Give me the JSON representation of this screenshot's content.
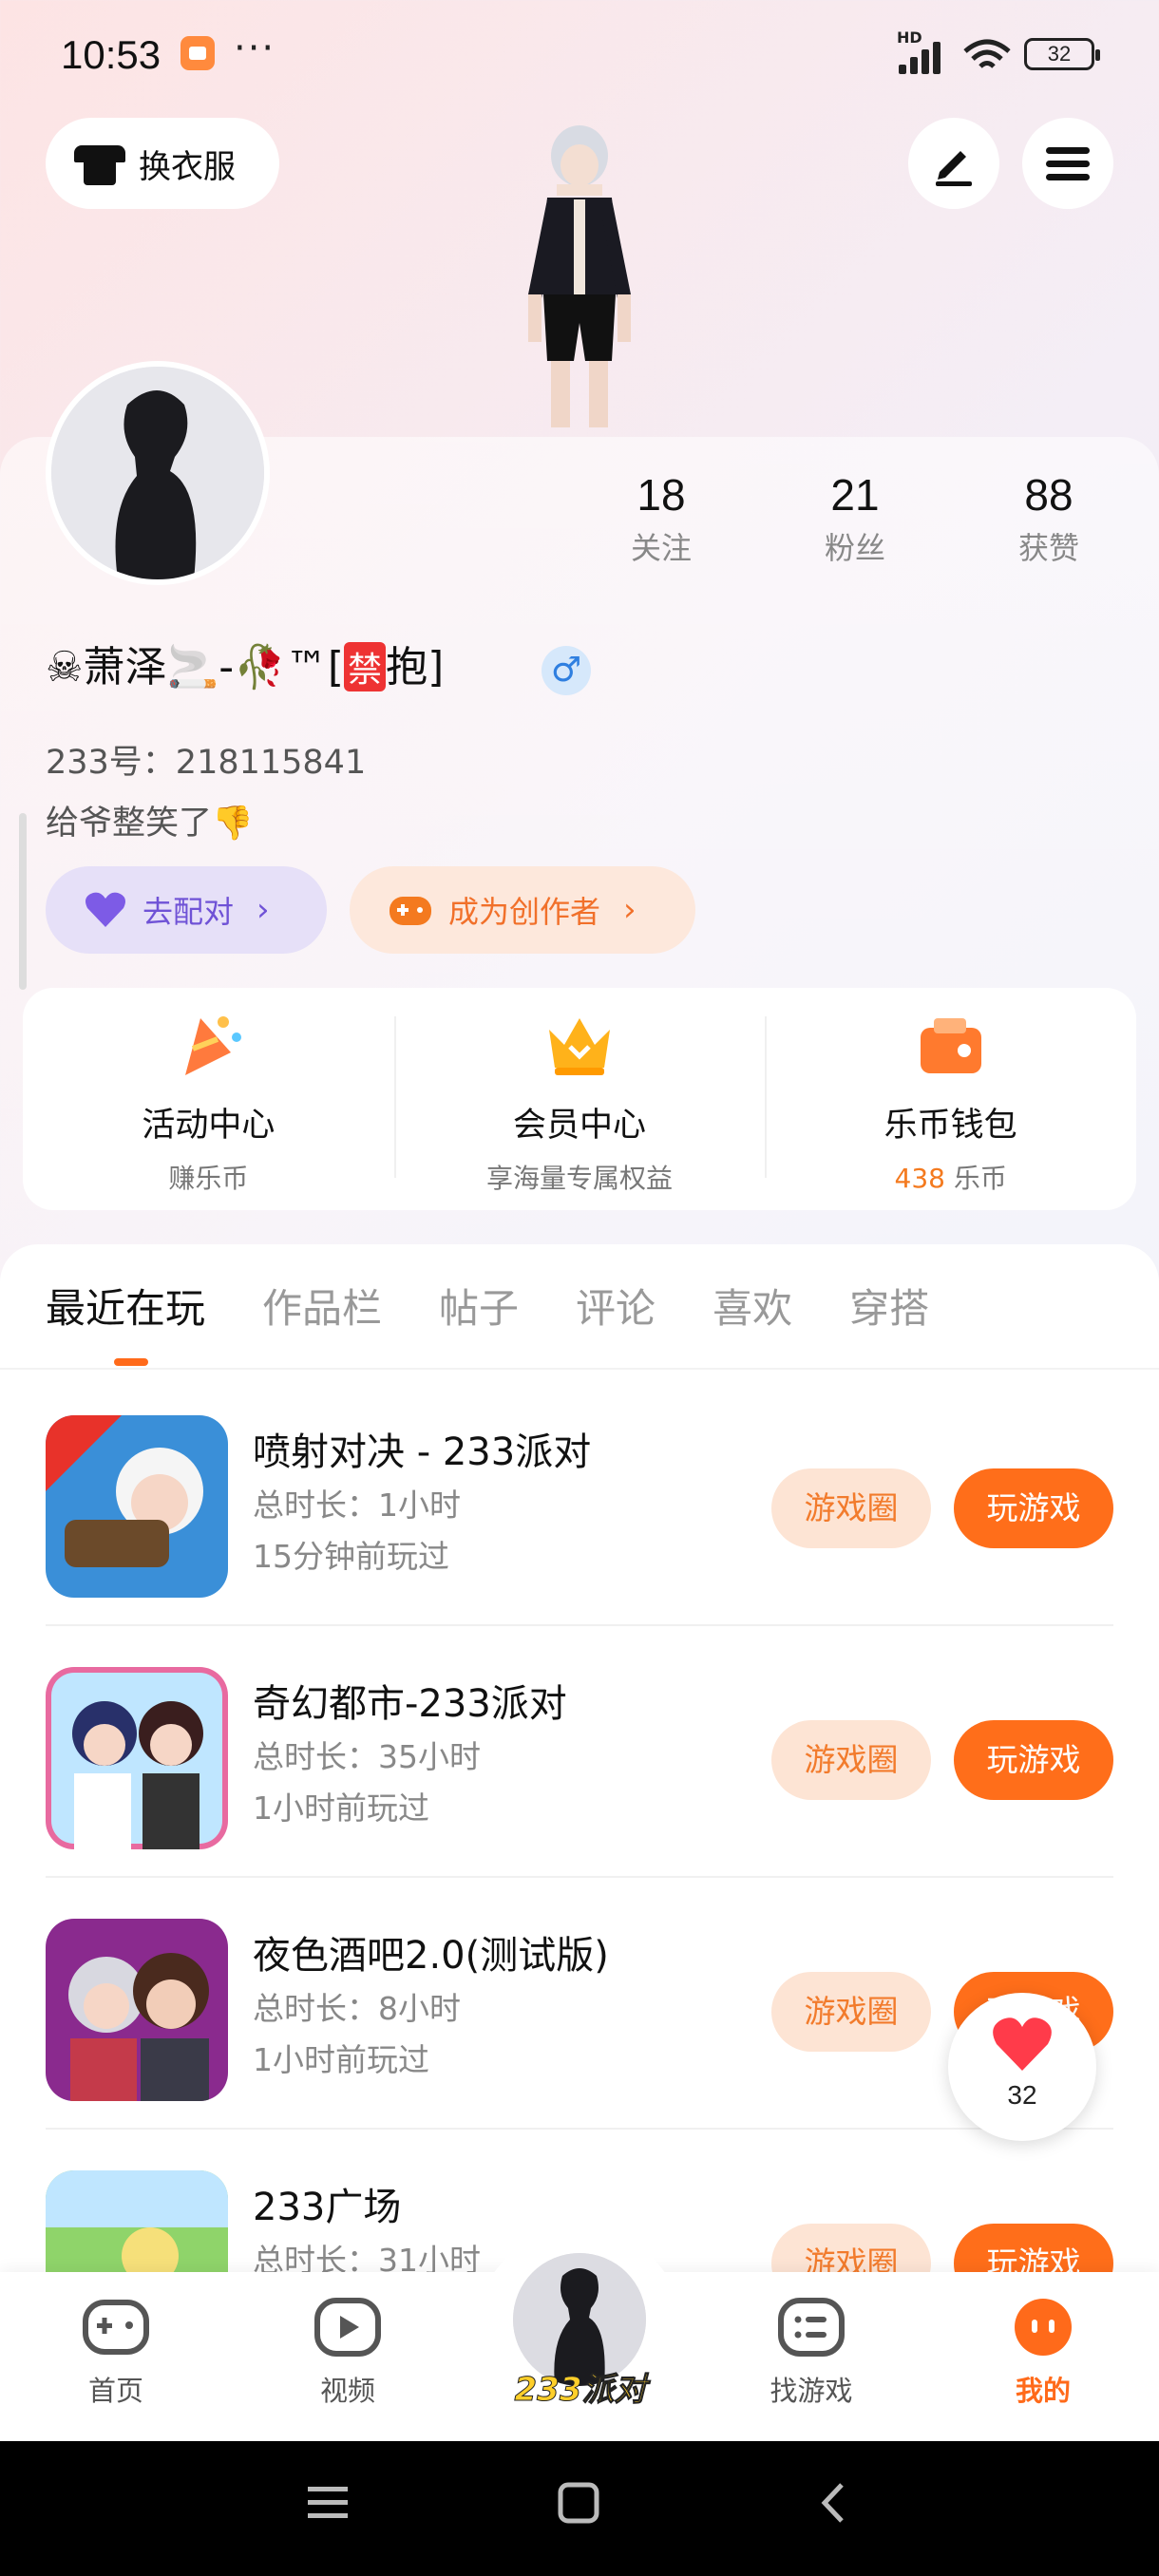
{
  "status_bar": {
    "time": "10:53",
    "dots": "···",
    "hd": "HD",
    "battery": "32"
  },
  "header": {
    "wardrobe_label": "换衣服"
  },
  "profile": {
    "nickname_prefix": "☠萧泽🚬-🥀™[",
    "ban_char": "禁",
    "nickname_suffix": "抱]",
    "gender": "♂",
    "uid": "233号：218115841",
    "bio": "给爷整笑了👎",
    "stats": [
      {
        "num": "18",
        "label": "关注"
      },
      {
        "num": "21",
        "label": "粉丝"
      },
      {
        "num": "88",
        "label": "获赞"
      }
    ],
    "match_label": "去配对",
    "creator_label": "成为创作者"
  },
  "quick": [
    {
      "title": "活动中心",
      "sub": "赚乐币",
      "icon": "party-icon"
    },
    {
      "title": "会员中心",
      "sub": "享海量专属权益",
      "icon": "crown-icon"
    },
    {
      "title": "乐币钱包",
      "sub_value": "438",
      "sub_unit": " 乐币",
      "icon": "wallet-icon"
    }
  ],
  "tabs": [
    "最近在玩",
    "作品栏",
    "帖子",
    "评论",
    "喜欢",
    "穿搭"
  ],
  "games": [
    {
      "name": "喷射对决 - 233派对",
      "time": "总时长：1小时",
      "last": "15分钟前玩过",
      "circle": "游戏圈",
      "play": "玩游戏"
    },
    {
      "name": "奇幻都市-233派对",
      "time": "总时长：35小时",
      "last": "1小时前玩过",
      "circle": "游戏圈",
      "play": "玩游戏"
    },
    {
      "name": "夜色酒吧2.0(测试版)",
      "time": "总时长：8小时",
      "last": "1小时前玩过",
      "circle": "游戏圈",
      "play": "玩游戏"
    },
    {
      "name": "233广场",
      "time": "总时长：31小时",
      "last": "",
      "circle": "游戏圈",
      "play": "玩游戏"
    }
  ],
  "float_like": {
    "count": "32"
  },
  "bottom_nav": {
    "home": "首页",
    "video": "视频",
    "center": "233派对",
    "find": "找游戏",
    "mine": "我的"
  },
  "colors": {
    "accent": "#ff6a1a",
    "purple": "#6f52d6",
    "light_orange": "#fde4d4"
  }
}
